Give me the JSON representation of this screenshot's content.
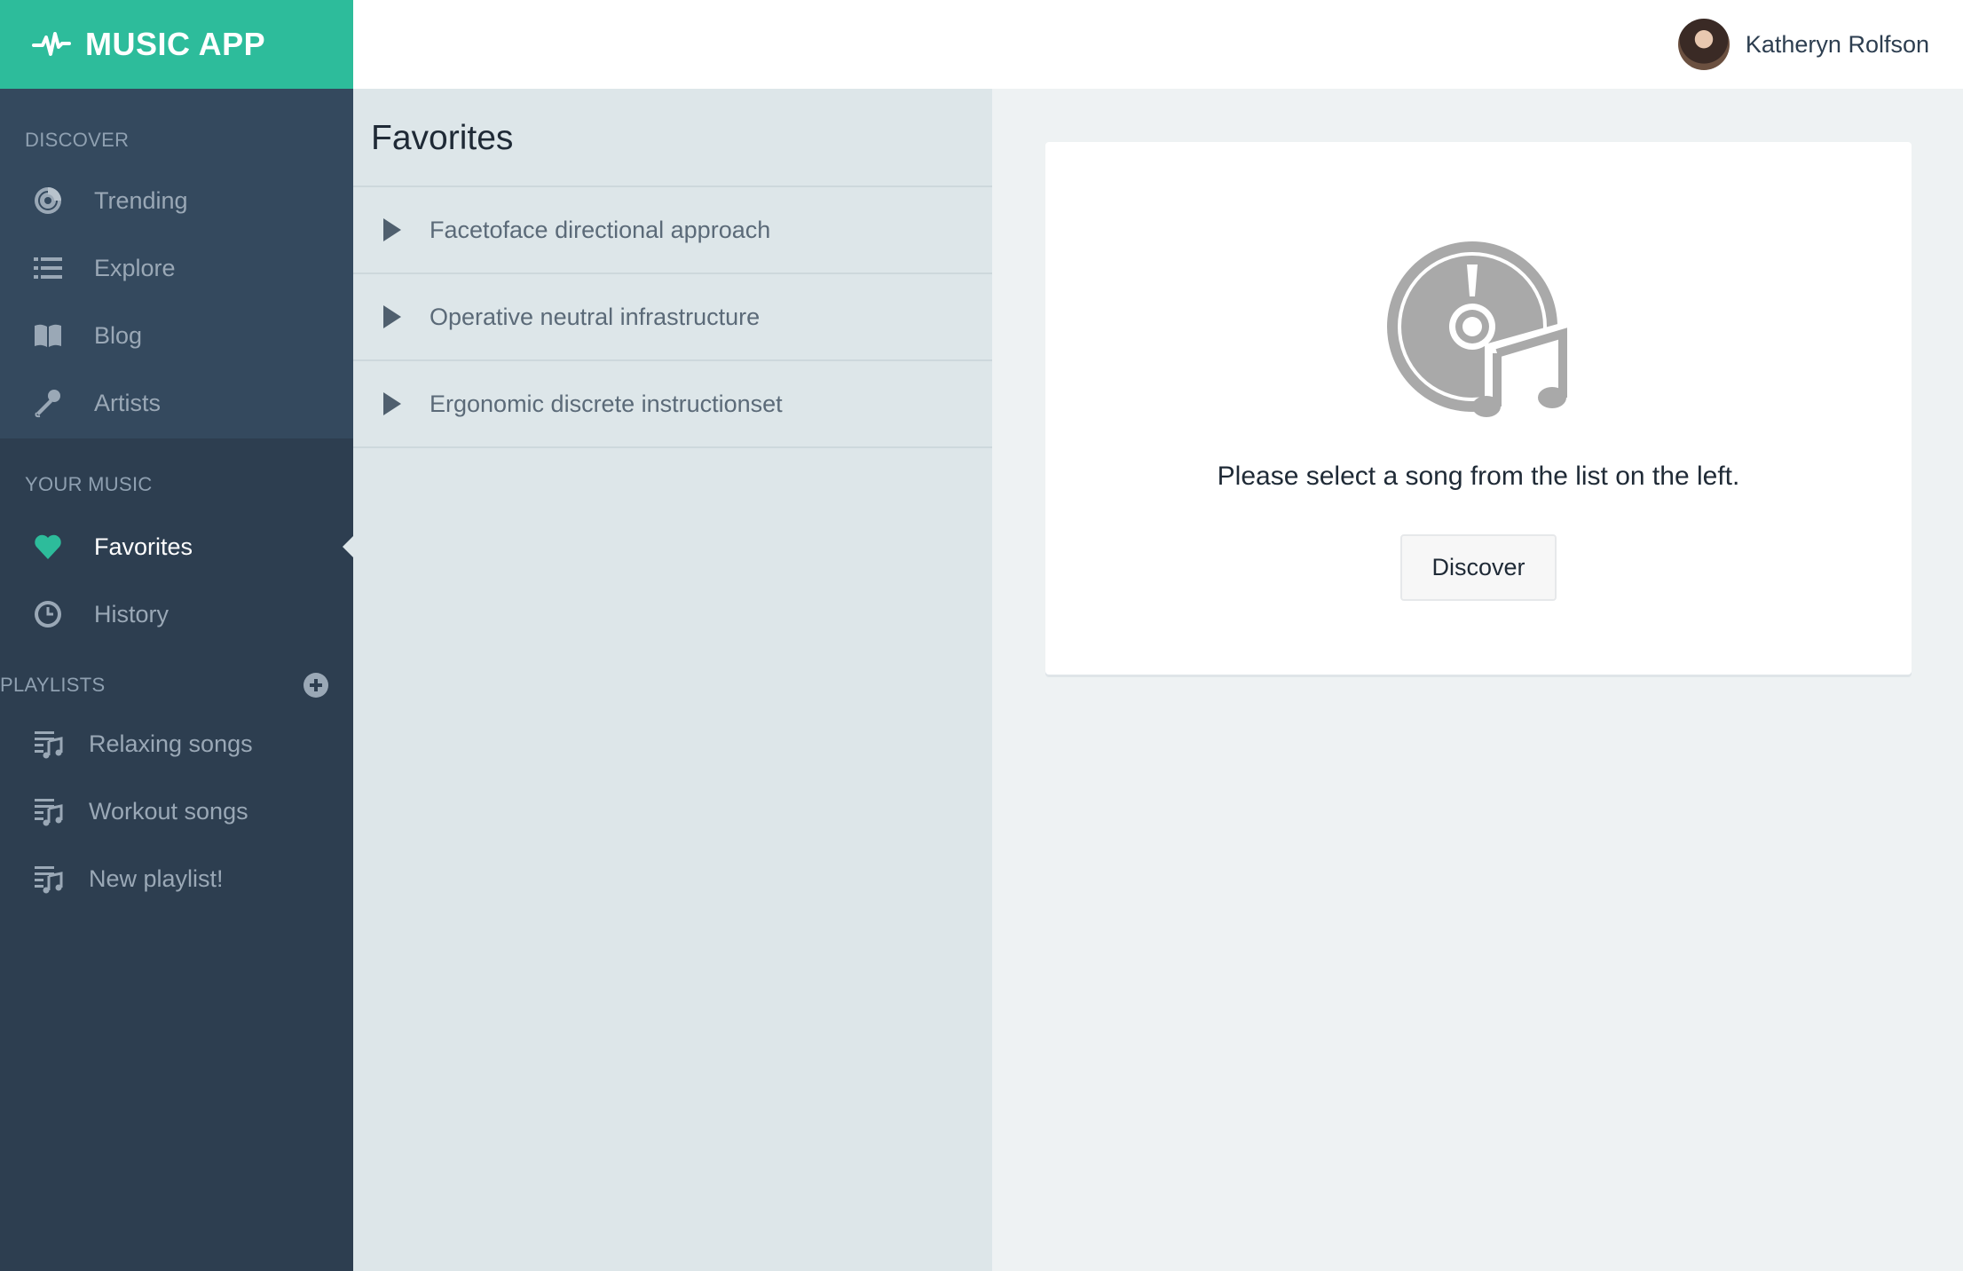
{
  "brand": {
    "title": "MUSIC APP",
    "icon": "pulse-icon"
  },
  "user": {
    "name": "Katheryn Rolfson"
  },
  "sidebar": {
    "discover": {
      "label": "DISCOVER",
      "items": [
        {
          "label": "Trending",
          "icon": "vinyl-icon"
        },
        {
          "label": "Explore",
          "icon": "list-icon"
        },
        {
          "label": "Blog",
          "icon": "book-icon"
        },
        {
          "label": "Artists",
          "icon": "microphone-icon"
        }
      ]
    },
    "your_music": {
      "label": "YOUR MUSIC",
      "items": [
        {
          "label": "Favorites",
          "icon": "heart-icon",
          "active": true
        },
        {
          "label": "History",
          "icon": "clock-icon"
        }
      ]
    },
    "playlists": {
      "label": "PLAYLISTS",
      "items": [
        {
          "label": "Relaxing songs",
          "icon": "playlist-icon"
        },
        {
          "label": "Workout songs",
          "icon": "playlist-icon"
        },
        {
          "label": "New playlist!",
          "icon": "playlist-icon"
        }
      ]
    }
  },
  "favorites": {
    "title": "Favorites",
    "songs": [
      {
        "title": "Facetoface directional approach"
      },
      {
        "title": "Operative neutral infrastructure"
      },
      {
        "title": "Ergonomic discrete instructionset"
      }
    ]
  },
  "main": {
    "prompt": "Please select a song from the list on the left.",
    "discover_button": "Discover"
  },
  "colors": {
    "brand": "#2dbc9b",
    "sidebar": "#2d3e50",
    "sidebar_discover": "#34495e",
    "list_panel": "#dde6e9",
    "active_icon": "#2dbc9b"
  }
}
